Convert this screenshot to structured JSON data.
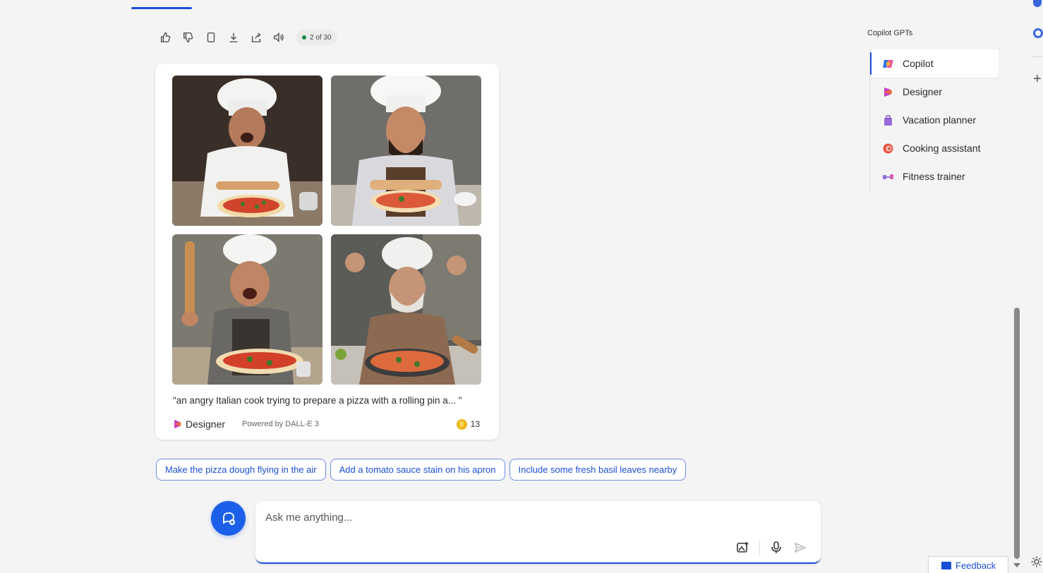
{
  "toolbar": {
    "icons": [
      "thumbs-up-icon",
      "thumbs-down-icon",
      "copy-icon",
      "download-icon",
      "share-icon",
      "read-aloud-icon"
    ],
    "counter": "2 of 30"
  },
  "card": {
    "images": [
      "angry-chef-image-1",
      "angry-chef-image-2",
      "angry-chef-image-3",
      "angry-chef-image-4"
    ],
    "caption": "\"an angry Italian cook trying to prepare a pizza with a rolling pin a... \"",
    "designer_label": "Designer",
    "powered_by": "Powered by DALL-E 3",
    "boosts": "13"
  },
  "suggestions": [
    "Make the pizza dough flying in the air",
    "Add a tomato sauce stain on his apron",
    "Include some fresh basil leaves nearby"
  ],
  "input": {
    "placeholder": "Ask me anything..."
  },
  "gpts": {
    "heading": "Copilot GPTs",
    "items": [
      {
        "label": "Copilot",
        "icon": "copilot-icon"
      },
      {
        "label": "Designer",
        "icon": "designer-icon"
      },
      {
        "label": "Vacation planner",
        "icon": "suitcase-icon"
      },
      {
        "label": "Cooking assistant",
        "icon": "cooking-icon"
      },
      {
        "label": "Fitness trainer",
        "icon": "dumbbell-icon"
      }
    ]
  },
  "feedback": "Feedback",
  "colors": {
    "accent": "#1a4fd6",
    "background": "#f4f4f5"
  }
}
